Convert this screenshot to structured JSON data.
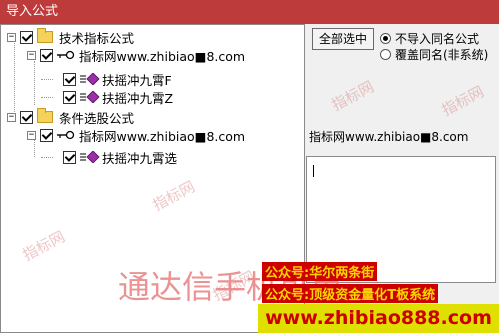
{
  "window": {
    "title": "导入公式"
  },
  "tree": {
    "root1": "技术指标公式",
    "root1_source": "指标网www.zhibiao■8.com",
    "root1_leaves": [
      "扶摇冲九霄F",
      "扶摇冲九霄Z"
    ],
    "root2": "条件选股公式",
    "root2_source": "指标网www.zhibiao■8.com",
    "root2_leaves": [
      "扶摇冲九霄选"
    ]
  },
  "controls": {
    "select_all": "全部选中",
    "radio_no_import": "不导入同名公式",
    "radio_overwrite": "覆盖同名(非系统)",
    "selected_source": "指标网www.zhibiao■8.com"
  },
  "overlay": {
    "big_text": "通达信手机可用",
    "promo_line1": "公众号:华尔两条街",
    "promo_line2": "公众号:顶级资金量化T板系统",
    "footer_url": "www.zhibiao888.com",
    "watermark": "指标网"
  }
}
